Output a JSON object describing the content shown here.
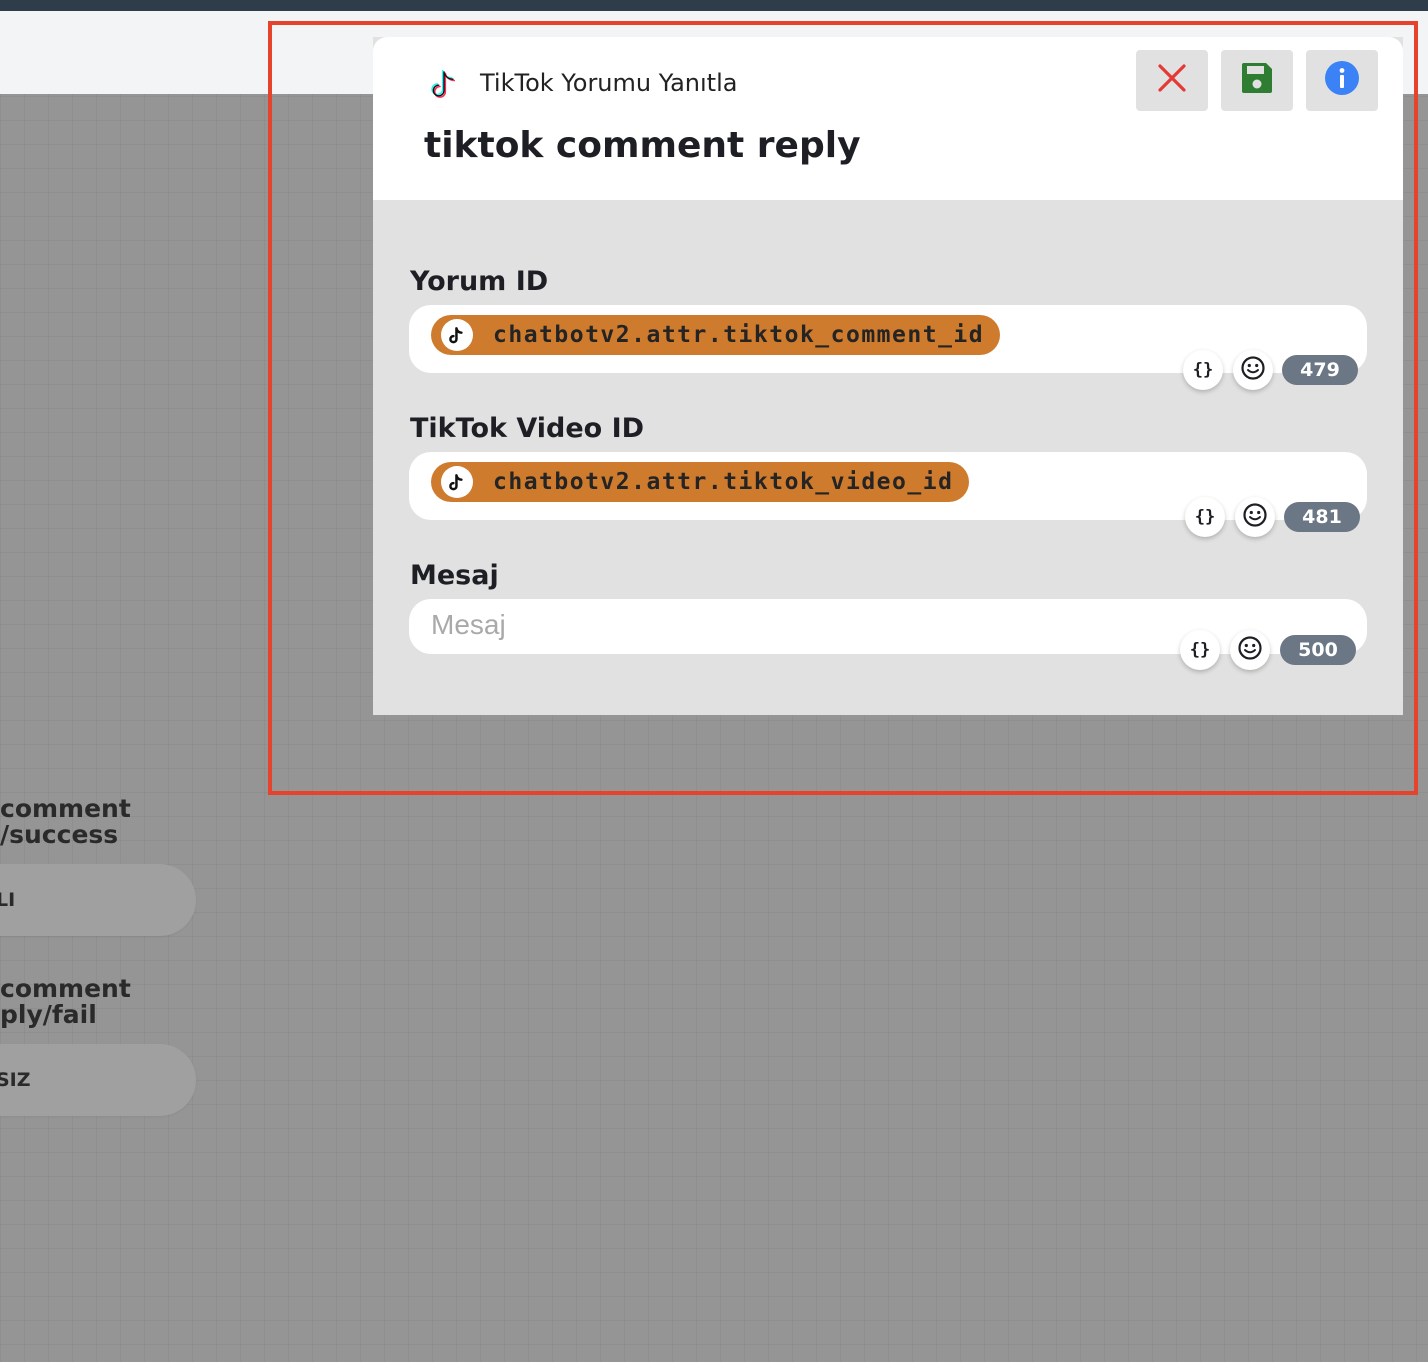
{
  "modal": {
    "subtitle": "TikTok Yorumu Yanıtla",
    "title": "tiktok comment reply",
    "buttons": {
      "close": "close",
      "save": "save",
      "info": "info"
    },
    "fields": [
      {
        "label": "Yorum ID",
        "chip_text": "chatbotv2.attr.tiktok_comment_id",
        "remaining": "479",
        "variable_button": "{}",
        "emoji_button": "☺"
      },
      {
        "label": "TikTok Video ID",
        "chip_text": "chatbotv2.attr.tiktok_video_id",
        "remaining": "481",
        "variable_button": "{}",
        "emoji_button": "☺"
      },
      {
        "label": "Mesaj",
        "placeholder": "Mesaj",
        "remaining": "500",
        "variable_button": "{}",
        "emoji_button": "☺"
      }
    ]
  },
  "canvas_nodes": [
    {
      "title_line1": "comment",
      "title_line2": "/success",
      "pill": "LI"
    },
    {
      "title_line1": "comment",
      "title_line2": "ply/fail",
      "pill": "SIZ"
    }
  ],
  "icons": {
    "tiktok": "tiktok-logo-icon",
    "close": "close-x-icon",
    "save": "floppy-disk-icon",
    "info": "info-circle-icon",
    "variables": "curly-braces-icon",
    "emoji": "smiley-icon"
  },
  "colors": {
    "chip": "#cf7b2e",
    "close_icon": "#e53935",
    "save_icon": "#2e7d32",
    "info_icon": "#3b82f6",
    "counter_badge": "#6b7785",
    "highlight_border": "#e5432c"
  }
}
